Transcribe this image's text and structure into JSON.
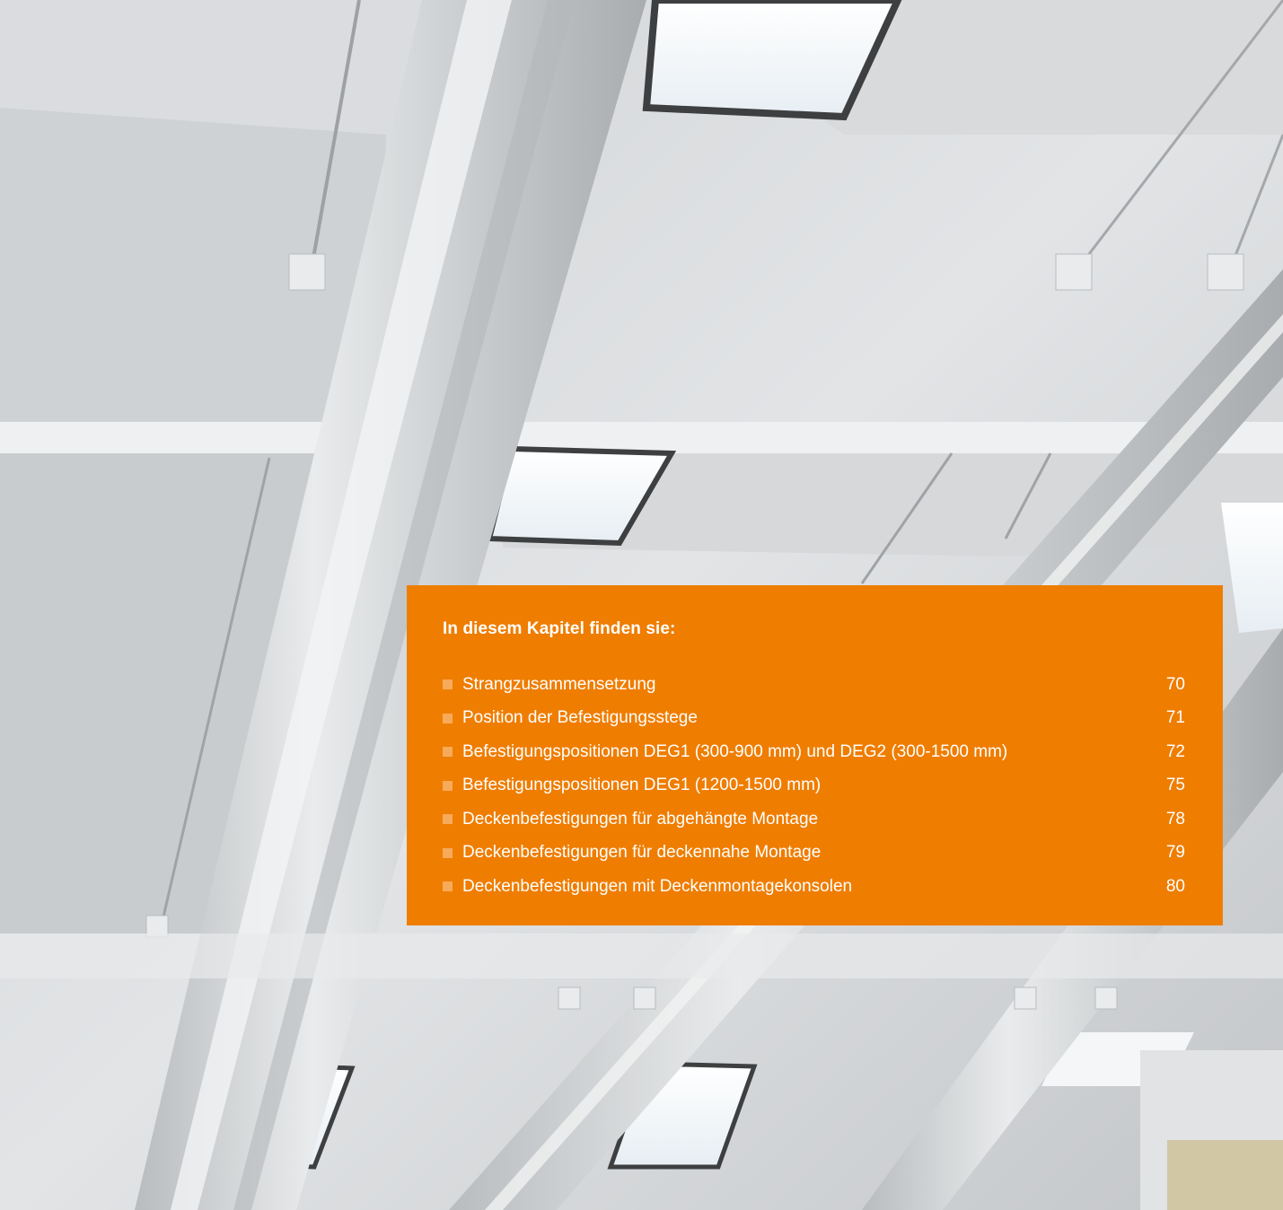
{
  "toc": {
    "heading": "In diesem Kapitel finden sie:",
    "items": [
      {
        "title": "Strangzusammensetzung",
        "page": "70"
      },
      {
        "title": "Position der Befestigungsstege",
        "page": "71"
      },
      {
        "title": "Befestigungspositionen DEG1 (300-900 mm) und DEG2 (300-1500 mm)",
        "page": "72"
      },
      {
        "title": "Befestigungspositionen DEG1 (1200-1500 mm)",
        "page": "75"
      },
      {
        "title": "Deckenbefestigungen für abgehängte Montage",
        "page": "78"
      },
      {
        "title": "Deckenbefestigungen für deckennahe Montage",
        "page": "79"
      },
      {
        "title": "Deckenbefestigungen mit Deckenmontagekonsolen",
        "page": "80"
      }
    ]
  },
  "colors": {
    "accent": "#ef7d00",
    "bullet": "#f7ab5a",
    "text": "#ffffff"
  },
  "icons": {
    "bullet": "square-bullet-icon"
  }
}
